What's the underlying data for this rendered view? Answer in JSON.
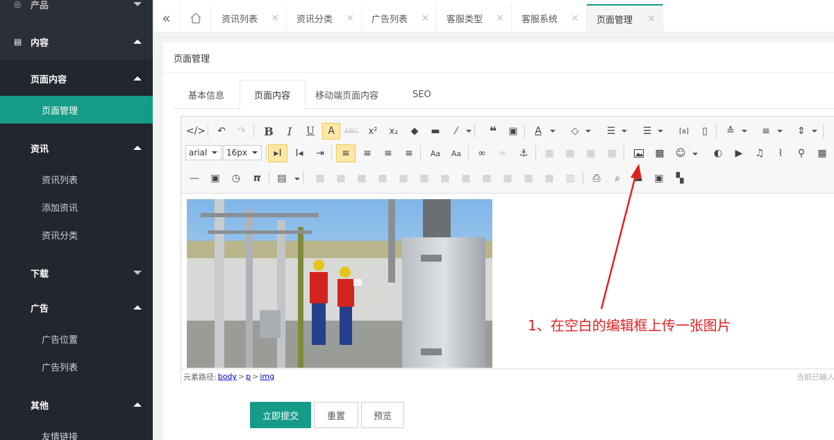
{
  "sidebar": {
    "partial_top_label": "产品",
    "groups": [
      {
        "label": "内容"
      },
      {
        "label": "页面内容"
      },
      {
        "label": "页面管理"
      },
      {
        "label": "资讯"
      },
      {
        "label": "资讯列表"
      },
      {
        "label": "添加资讯"
      },
      {
        "label": "资讯分类"
      },
      {
        "label": "下载"
      },
      {
        "label": "广告"
      },
      {
        "label": "广告位置"
      },
      {
        "label": "广告列表"
      },
      {
        "label": "其他"
      },
      {
        "label": "友情链接"
      }
    ]
  },
  "topbar": {
    "tabs": [
      {
        "label": "资讯列表",
        "close": "×"
      },
      {
        "label": "资讯分类",
        "close": "×"
      },
      {
        "label": "广告列表",
        "close": "×"
      },
      {
        "label": "客服类型",
        "close": "×"
      },
      {
        "label": "客服系统",
        "close": "×"
      },
      {
        "label": "页面管理",
        "close": "×"
      }
    ]
  },
  "panel": {
    "title": "页面管理",
    "tabs": [
      "基本信息",
      "页面内容",
      "移动端页面内容",
      "SEO"
    ]
  },
  "editor": {
    "font_family": "arial",
    "font_size": "16px",
    "path_label": "元素路径:",
    "path": [
      "body",
      "p",
      "img"
    ],
    "path_sep": ">",
    "status_right": "当前已输入",
    "annotation": "1、在空白的编辑框上传一张图片"
  },
  "buttons": {
    "submit": "立即提交",
    "reset": "重置",
    "preview": "预览"
  },
  "colors": {
    "sidebar_bg": "#2b2f3a",
    "accent": "#159c89",
    "annotation_red": "#e02020"
  }
}
